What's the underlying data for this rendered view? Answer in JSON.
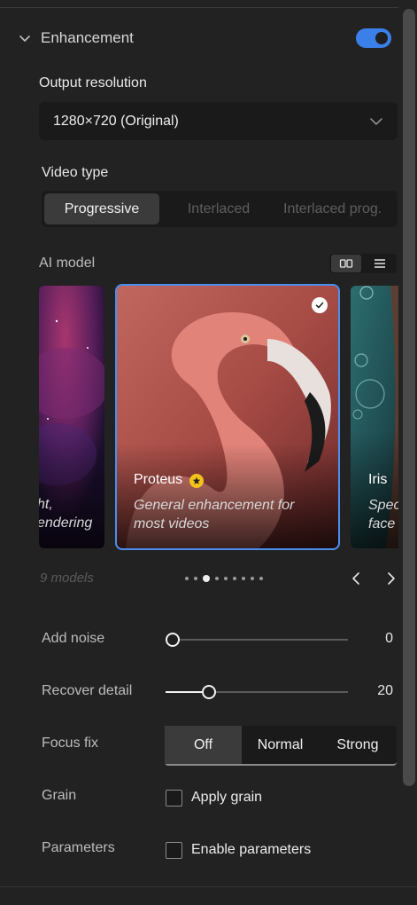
{
  "section": {
    "title": "Enhancement",
    "enabled": true
  },
  "output_resolution": {
    "label": "Output resolution",
    "value": "1280×720 (Original)"
  },
  "video_type": {
    "label": "Video type",
    "options": [
      "Progressive",
      "Interlaced",
      "Interlaced prog."
    ],
    "selected": "Progressive"
  },
  "ai_model": {
    "label": "AI model",
    "view_modes": [
      "grid-icon",
      "list-icon"
    ],
    "cards": [
      {
        "title": "",
        "desc_line1": "ht,",
        "desc_line2": "endering"
      },
      {
        "title": "Proteus",
        "desc_line1": "General enhancement for",
        "desc_line2": "most videos",
        "selected": true
      },
      {
        "title": "Iris",
        "desc_line1": "Spec",
        "desc_line2": "face"
      }
    ],
    "count_text": "9 models",
    "page_dots": 9,
    "active_dot": 3
  },
  "add_noise": {
    "label": "Add noise",
    "value": "0",
    "fraction": 0.0
  },
  "recover_detail": {
    "label": "Recover detail",
    "value": "20",
    "fraction": 0.2
  },
  "focus_fix": {
    "label": "Focus fix",
    "options": [
      "Off",
      "Normal",
      "Strong"
    ],
    "selected": "Off"
  },
  "grain": {
    "label": "Grain",
    "checkbox_label": "Apply grain",
    "checked": false
  },
  "parameters": {
    "label": "Parameters",
    "checkbox_label": "Enable parameters",
    "checked": false
  },
  "colors": {
    "accent": "#3b80e9",
    "star": "#f3c21b",
    "panel_bg": "#222222",
    "field_bg": "#1a1a1a"
  }
}
